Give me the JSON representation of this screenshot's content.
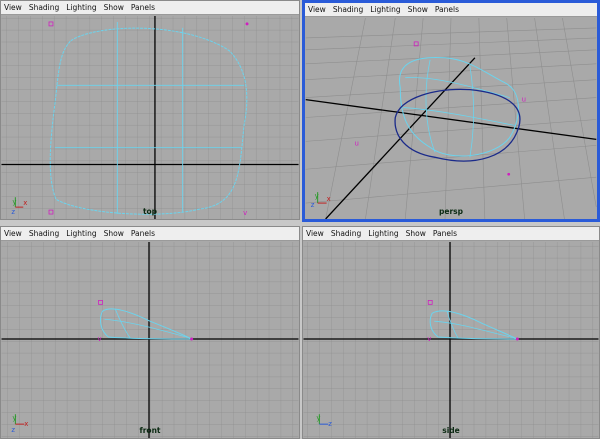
{
  "menu": [
    "View",
    "Shading",
    "Lighting",
    "Show",
    "Panels"
  ],
  "viewports": {
    "top": {
      "camera": "top"
    },
    "persp": {
      "camera": "persp"
    },
    "front": {
      "camera": "front"
    },
    "side": {
      "camera": "side"
    }
  },
  "colors": {
    "accent": "#2a5bd8",
    "grid": "#8e8e8e",
    "background": "#a9a9a9",
    "curve": "#6bd4ee",
    "selected_curve": "#1a2a8a",
    "locator": "#d020c0"
  },
  "axis": {
    "x": "x",
    "y": "y",
    "z": "z"
  }
}
